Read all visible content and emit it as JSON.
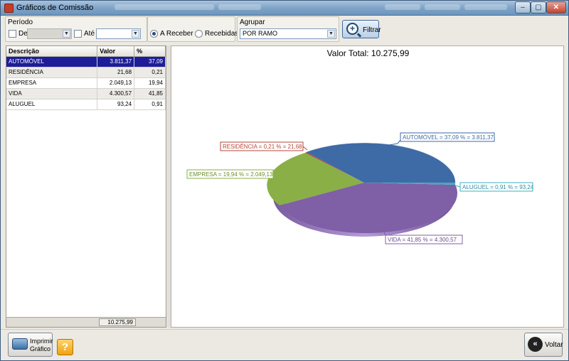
{
  "window": {
    "title": "Gráficos de Comissão",
    "controls": {
      "minimize": "‒",
      "maximize": "▢",
      "close": "✕"
    }
  },
  "filters": {
    "period_label": "Período",
    "from_label": "De",
    "to_label": "Até",
    "from_value": "",
    "to_value": "",
    "status_options": [
      "A Receber",
      "Recebidas"
    ],
    "status_selected": "A Receber",
    "group_label": "Agrupar",
    "group_value": "POR RAMO",
    "filter_button": "Filtrar"
  },
  "table": {
    "columns": [
      "Descrição",
      "Valor",
      "%"
    ],
    "rows": [
      {
        "descricao": "AUTOMÓVEL",
        "valor": "3.811,37",
        "pct": "37,09"
      },
      {
        "descricao": "RESIDÊNCIA",
        "valor": "21,68",
        "pct": "0,21"
      },
      {
        "descricao": "EMPRESA",
        "valor": "2.049,13",
        "pct": "19,94"
      },
      {
        "descricao": "VIDA",
        "valor": "4.300,57",
        "pct": "41,85"
      },
      {
        "descricao": "ALUGUEL",
        "valor": "93,24",
        "pct": "0,91"
      }
    ],
    "total": "10.275,99"
  },
  "chart": {
    "title": "Valor Total: 10.275,99",
    "labels": {
      "automovel": "AUTOMÓVEL = 37,09 % = 3.811,37",
      "residencia": "RESIDÊNCIA = 0,21 % = 21,68",
      "empresa": "EMPRESA = 19,94 % = 2.049,13",
      "aluguel": "ALUGUEL = 0,91 % = 93,24",
      "vida": "VIDA = 41,85 % = 4.300,57"
    },
    "colors": {
      "automovel": "#3e6aa5",
      "residencia": "#b5443a",
      "empresa": "#8aaf46",
      "aluguel": "#3bb0c2",
      "vida": "#7f5fa6"
    }
  },
  "chart_data": {
    "type": "pie",
    "title": "Valor Total: 10.275,99",
    "categories": [
      "AUTOMÓVEL",
      "RESIDÊNCIA",
      "EMPRESA",
      "VIDA",
      "ALUGUEL"
    ],
    "values": [
      3811.37,
      21.68,
      2049.13,
      4300.57,
      93.24
    ],
    "percentages": [
      37.09,
      0.21,
      19.94,
      41.85,
      0.91
    ]
  },
  "bottom": {
    "print_label_1": "Imprimir",
    "print_label_2": "Gráfico",
    "help_icon": "?",
    "back_label": "Voltar"
  }
}
